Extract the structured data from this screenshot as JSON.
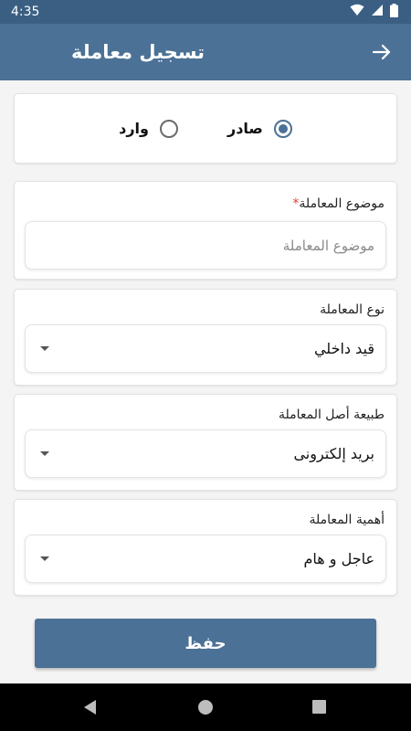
{
  "status_bar": {
    "time": "4:35"
  },
  "app_bar": {
    "title": "تسجيل معاملة"
  },
  "direction": {
    "options": [
      {
        "label": "صادر",
        "selected": true
      },
      {
        "label": "وارد",
        "selected": false
      }
    ]
  },
  "fields": {
    "subject": {
      "label": "موضوع المعاملة",
      "required_mark": "*",
      "placeholder": "موضوع المعاملة",
      "value": ""
    },
    "type": {
      "label": "نوع المعاملة",
      "value": "قيد داخلي"
    },
    "origin_nature": {
      "label": "طبيعة أصل المعاملة",
      "value": "بريد إلكترونى"
    },
    "importance": {
      "label": "أهمية المعاملة",
      "value": "عاجل و هام"
    }
  },
  "save_button": {
    "label": "حفظ"
  },
  "colors": {
    "primary": "#4b7196",
    "status_bar": "#3a5f83",
    "required": "#e53935"
  }
}
